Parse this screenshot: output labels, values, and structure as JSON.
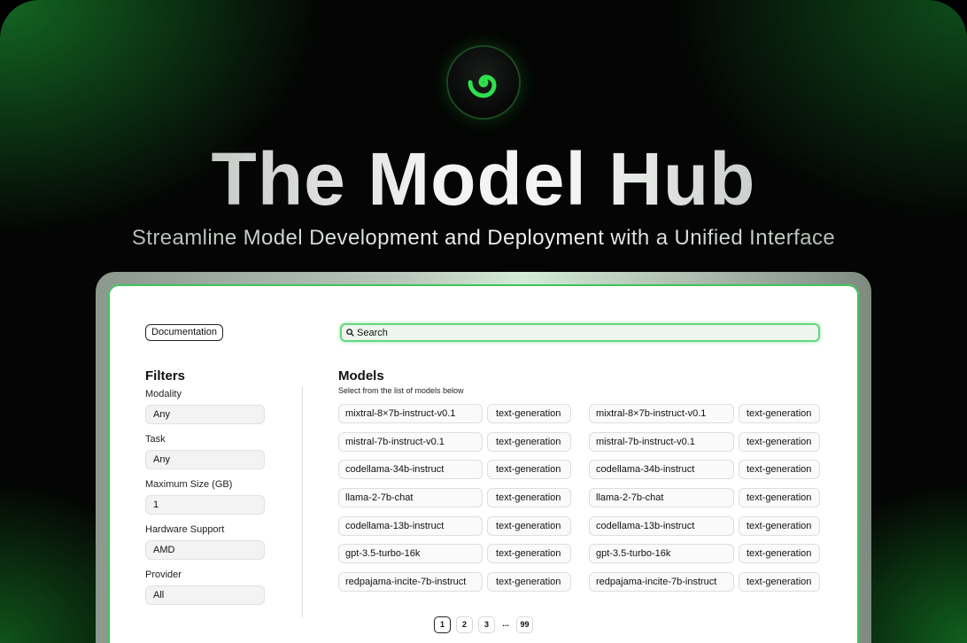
{
  "hero": {
    "title": "The Model Hub",
    "subtitle": "Streamline Model Development and Deployment with a Unified Interface",
    "logo_icon": "green-spiral-logo-icon",
    "accent_color": "#2ecc40"
  },
  "toolbar": {
    "documentation_label": "Documentation",
    "search_placeholder": "Search"
  },
  "filters": {
    "heading": "Filters",
    "items": [
      {
        "label": "Modality",
        "value": "Any"
      },
      {
        "label": "Task",
        "value": "Any"
      },
      {
        "label": "Maximum Size (GB)",
        "value": "1"
      },
      {
        "label": "Hardware Support",
        "value": "AMD"
      },
      {
        "label": "Provider",
        "value": "All"
      }
    ]
  },
  "models": {
    "heading": "Models",
    "subtitle": "Select from the list of models below",
    "rows": [
      {
        "left": {
          "name": "mixtral-8×7b-instruct-v0.1",
          "task": "text-generation"
        },
        "right": {
          "name": "mixtral-8×7b-instruct-v0.1",
          "task": "text-generation"
        }
      },
      {
        "left": {
          "name": "mistral-7b-instruct-v0.1",
          "task": "text-generation"
        },
        "right": {
          "name": "mistral-7b-instruct-v0.1",
          "task": "text-generation"
        }
      },
      {
        "left": {
          "name": "codellama-34b-instruct",
          "task": "text-generation"
        },
        "right": {
          "name": "codellama-34b-instruct",
          "task": "text-generation"
        }
      },
      {
        "left": {
          "name": "llama-2-7b-chat",
          "task": "text-generation"
        },
        "right": {
          "name": "llama-2-7b-chat",
          "task": "text-generation"
        }
      },
      {
        "left": {
          "name": "codellama-13b-instruct",
          "task": "text-generation"
        },
        "right": {
          "name": "codellama-13b-instruct",
          "task": "text-generation"
        }
      },
      {
        "left": {
          "name": "gpt-3.5-turbo-16k",
          "task": "text-generation"
        },
        "right": {
          "name": "gpt-3.5-turbo-16k",
          "task": "text-generation"
        }
      },
      {
        "left": {
          "name": "redpajama-incite-7b-instruct",
          "task": "text-generation"
        },
        "right": {
          "name": "redpajama-incite-7b-instruct",
          "task": "text-generation"
        }
      }
    ]
  },
  "pagination": {
    "pages": [
      "1",
      "2",
      "3"
    ],
    "ellipsis": "...",
    "last": "99",
    "current": "1"
  }
}
